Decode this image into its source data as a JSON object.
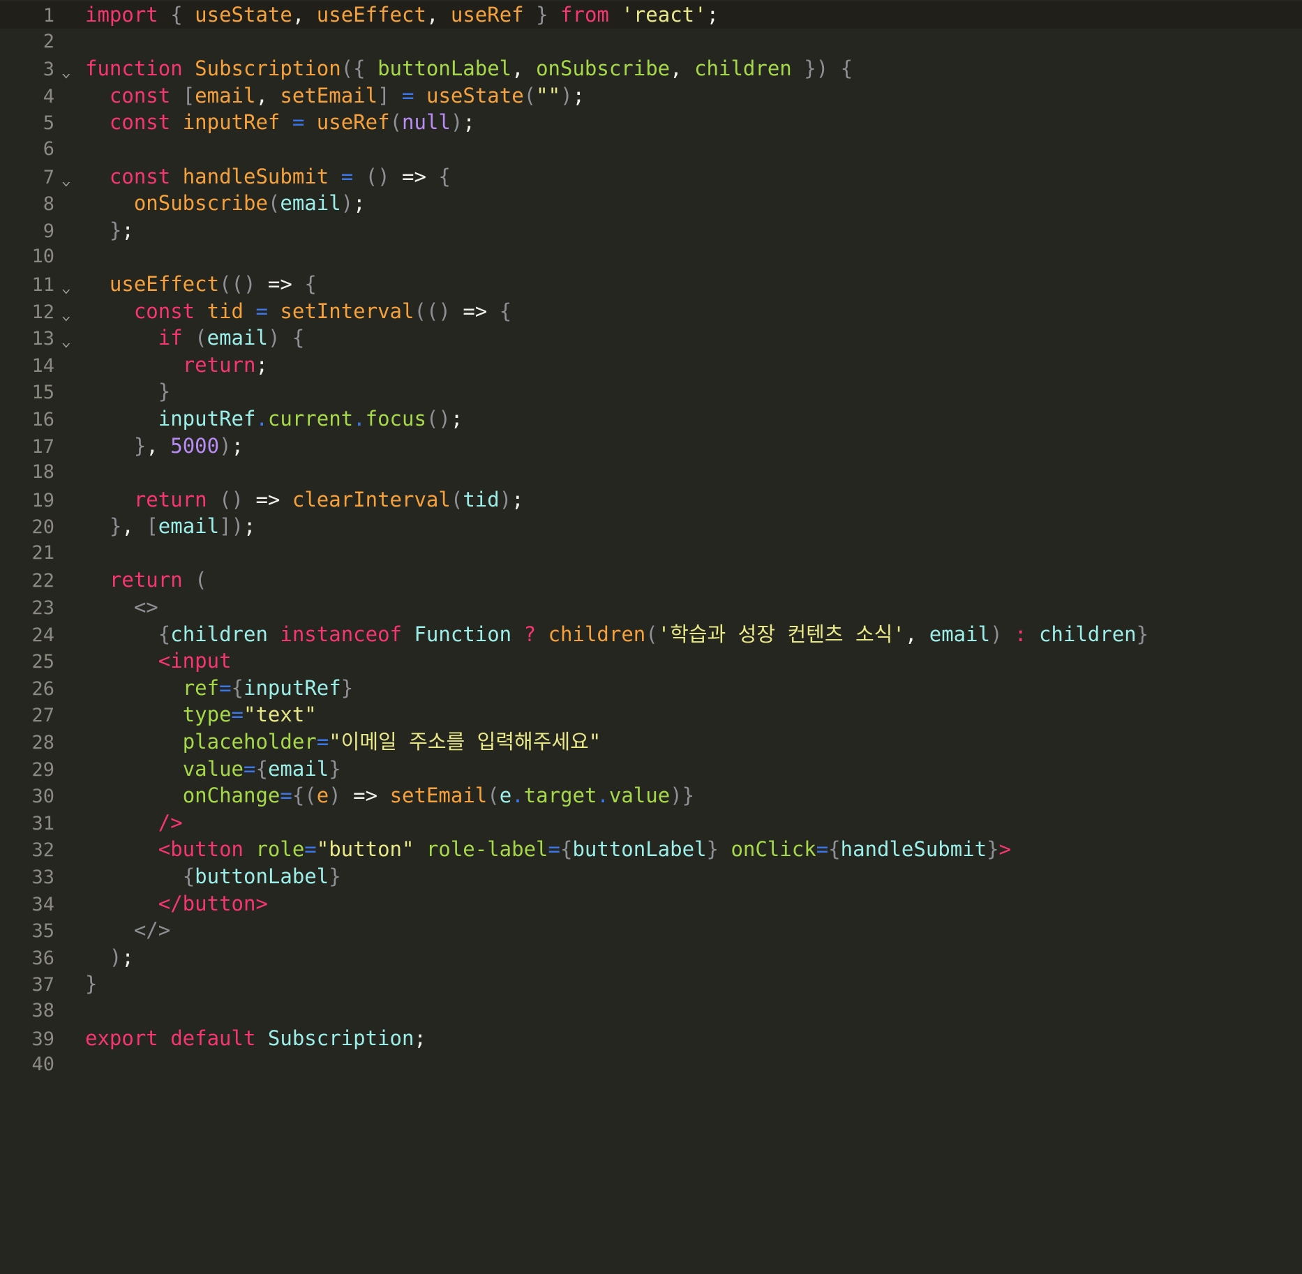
{
  "editor": {
    "background": "#262620",
    "active_line_background": "#201f1a",
    "gutter_color": "#8a8a80",
    "language": "jsx",
    "total_lines": 40,
    "active_line": 1,
    "fold_markers": [
      3,
      7,
      11,
      12,
      13
    ],
    "palette": {
      "keyword": "#f7366f",
      "function": "#f5a13c",
      "identifier_cyan": "#9ceee8",
      "attribute_green": "#a6d94a",
      "string": "#e8e888",
      "number": "#b98cf5",
      "punctuation": "#8d9094",
      "operator_blue": "#3b77e8",
      "arrow_white": "#f2f2ea"
    }
  },
  "lines": [
    {
      "n": "1",
      "text": "import { useState, useEffect, useRef } from 'react';"
    },
    {
      "n": "2",
      "text": ""
    },
    {
      "n": "3",
      "text": "function Subscription({ buttonLabel, onSubscribe, children }) {"
    },
    {
      "n": "4",
      "text": "  const [email, setEmail] = useState(\"\");"
    },
    {
      "n": "5",
      "text": "  const inputRef = useRef(null);"
    },
    {
      "n": "6",
      "text": ""
    },
    {
      "n": "7",
      "text": "  const handleSubmit = () => {"
    },
    {
      "n": "8",
      "text": "    onSubscribe(email);"
    },
    {
      "n": "9",
      "text": "  };"
    },
    {
      "n": "10",
      "text": ""
    },
    {
      "n": "11",
      "text": "  useEffect(() => {"
    },
    {
      "n": "12",
      "text": "    const tid = setInterval(() => {"
    },
    {
      "n": "13",
      "text": "      if (email) {"
    },
    {
      "n": "14",
      "text": "        return;"
    },
    {
      "n": "15",
      "text": "      }"
    },
    {
      "n": "16",
      "text": "      inputRef.current.focus();"
    },
    {
      "n": "17",
      "text": "    }, 5000);"
    },
    {
      "n": "18",
      "text": ""
    },
    {
      "n": "19",
      "text": "    return () => clearInterval(tid);"
    },
    {
      "n": "20",
      "text": "  }, [email]);"
    },
    {
      "n": "21",
      "text": ""
    },
    {
      "n": "22",
      "text": "  return ("
    },
    {
      "n": "23",
      "text": "    <>"
    },
    {
      "n": "24",
      "text": "      {children instanceof Function ? children('학습과 성장 컨텐츠 소식', email) : children}"
    },
    {
      "n": "25",
      "text": "      <input"
    },
    {
      "n": "26",
      "text": "        ref={inputRef}"
    },
    {
      "n": "27",
      "text": "        type=\"text\""
    },
    {
      "n": "28",
      "text": "        placeholder=\"이메일 주소를 입력해주세요\""
    },
    {
      "n": "29",
      "text": "        value={email}"
    },
    {
      "n": "30",
      "text": "        onChange={(e) => setEmail(e.target.value)}"
    },
    {
      "n": "31",
      "text": "      />"
    },
    {
      "n": "32",
      "text": "      <button role=\"button\" role-label={buttonLabel} onClick={handleSubmit}>"
    },
    {
      "n": "33",
      "text": "        {buttonLabel}"
    },
    {
      "n": "34",
      "text": "      </button>"
    },
    {
      "n": "35",
      "text": "    </>"
    },
    {
      "n": "36",
      "text": "  );"
    },
    {
      "n": "37",
      "text": "}"
    },
    {
      "n": "38",
      "text": ""
    },
    {
      "n": "39",
      "text": "export default Subscription;"
    },
    {
      "n": "40",
      "text": ""
    }
  ],
  "strings": {
    "react_module": "'react'",
    "empty_state": "\"\"",
    "interval_ms": "5000",
    "korean_newsletter_title": "'학습과 성장 컨텐츠 소식'",
    "input_type": "\"text\"",
    "korean_placeholder": "\"이메일 주소를 입력해주세요\"",
    "button_role": "\"button\""
  },
  "symbols": {
    "component_name": "Subscription",
    "props": [
      "buttonLabel",
      "onSubscribe",
      "children"
    ],
    "state": [
      "email",
      "setEmail"
    ],
    "refs": [
      "inputRef"
    ],
    "handlers": [
      "handleSubmit"
    ],
    "hooks": [
      "useState",
      "useEffect",
      "useRef"
    ],
    "timers": [
      "setInterval",
      "clearInterval",
      "tid"
    ]
  },
  "fold_icon": "⌄"
}
